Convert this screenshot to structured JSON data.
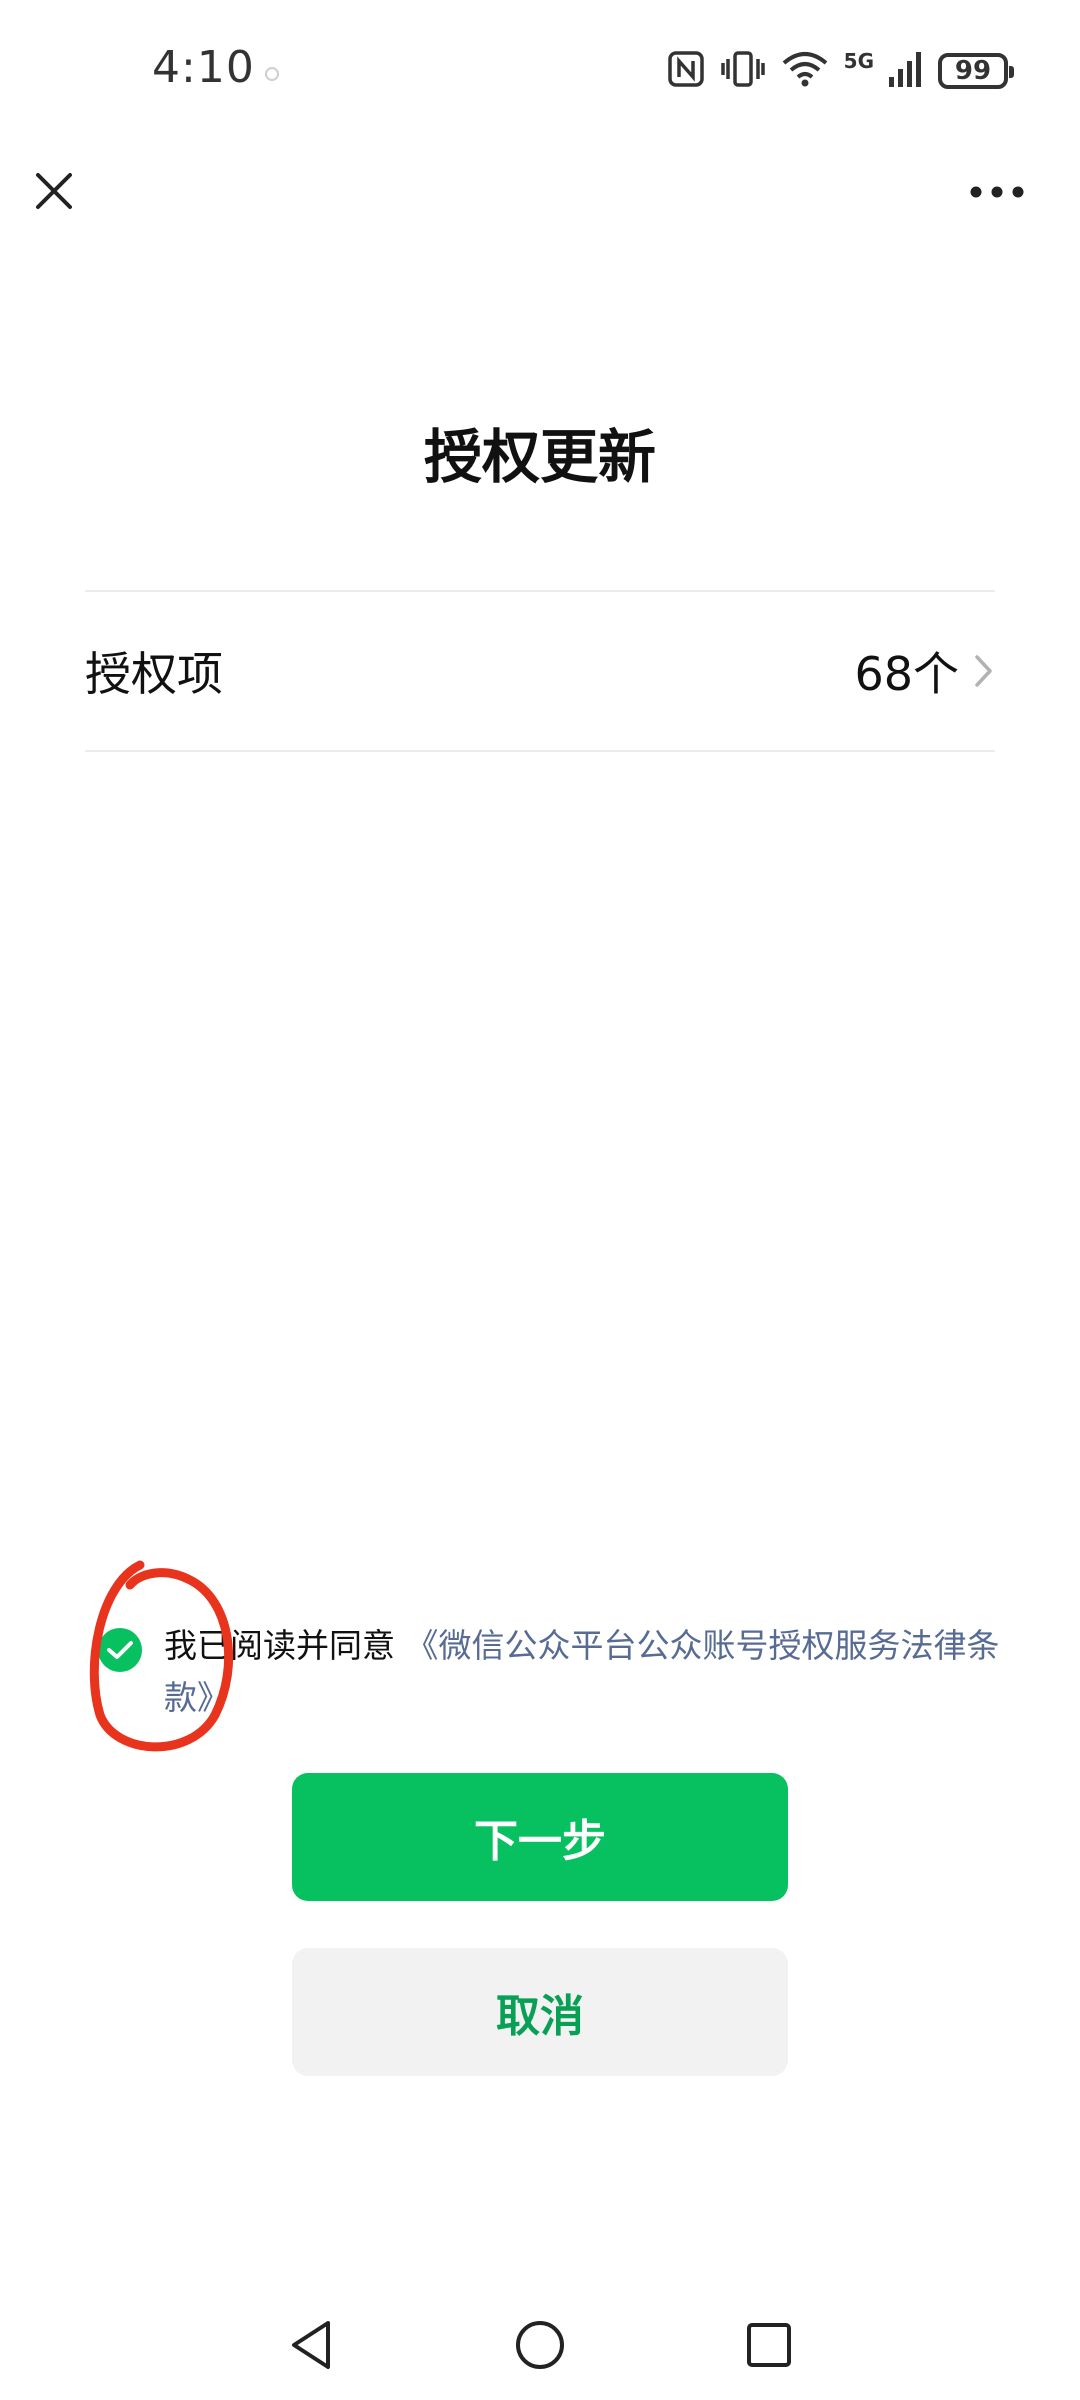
{
  "status_bar": {
    "time": "4:10",
    "battery": "99",
    "network": "5G"
  },
  "nav": {
    "close_icon": "close-icon",
    "more_icon": "more-dots-icon"
  },
  "page": {
    "title": "授权更新"
  },
  "auth_item": {
    "label": "授权项",
    "count": "68个"
  },
  "agreement": {
    "text": "我已阅读并同意",
    "link": "《微信公众平台公众账号授权服务法律条款》",
    "checked": true
  },
  "buttons": {
    "next": "下一步",
    "cancel": "取消"
  },
  "colors": {
    "accent": "#07c160",
    "link": "#576b95",
    "annotation": "#e8341c"
  },
  "system_nav": {
    "back_icon": "back-triangle-icon",
    "home_icon": "home-circle-icon",
    "recents_icon": "recents-square-icon"
  }
}
